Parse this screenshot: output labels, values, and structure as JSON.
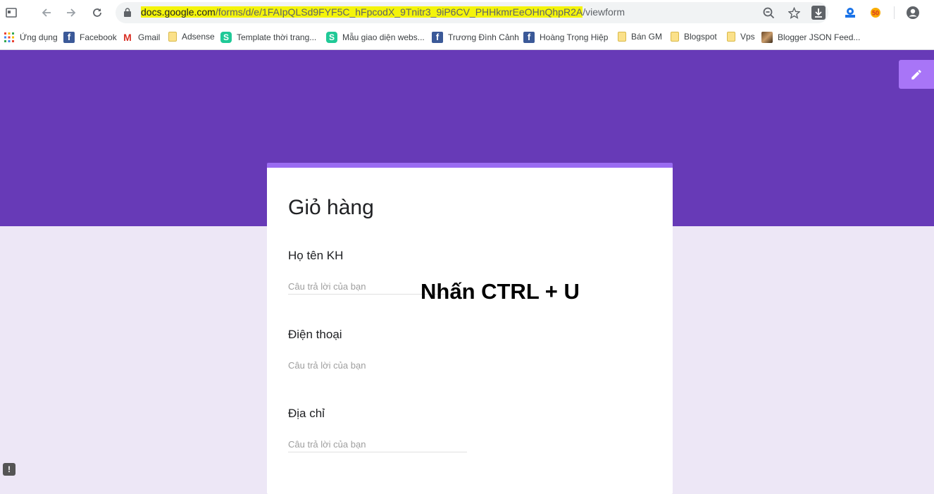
{
  "browser": {
    "url": {
      "domain_hl": "docs.google.com",
      "path_hl": "/forms/d/e/1FAIpQLSd9FYF5C_hFpcodX_9Tnitr3_9iP6CV_PHHkmrEeOHnQhpR2A",
      "suffix": "/viewform"
    },
    "nav_icons": [
      "sidebar-icon",
      "back-icon",
      "forward-icon",
      "reload-icon",
      "lock-icon"
    ],
    "right_icons": [
      "zoom-out-icon",
      "star-icon",
      "download-icon",
      "extension-icon",
      "extension-icon-2",
      "account-icon"
    ]
  },
  "bookmarks": [
    {
      "label": "Ứng dụng",
      "icon": "apps-grid-icon"
    },
    {
      "label": "Facebook",
      "icon": "facebook-icon"
    },
    {
      "label": "Gmail",
      "icon": "gmail-icon"
    },
    {
      "label": "Adsense",
      "icon": "folder-icon"
    },
    {
      "label": "Template thời trang...",
      "icon": "s-logo-icon"
    },
    {
      "label": "Mẫu giao diện webs...",
      "icon": "s-logo-icon"
    },
    {
      "label": "Trương Đình Cảnh",
      "icon": "facebook-icon"
    },
    {
      "label": "Hoàng Trọng Hiệp",
      "icon": "facebook-icon"
    },
    {
      "label": "Bán GM",
      "icon": "folder-icon"
    },
    {
      "label": "Blogspot",
      "icon": "folder-icon"
    },
    {
      "label": "Vps",
      "icon": "folder-icon"
    },
    {
      "label": "Blogger JSON Feed...",
      "icon": "photo-icon"
    }
  ],
  "form": {
    "title": "Giỏ hàng",
    "questions": [
      {
        "label": "Họ tên KH",
        "placeholder": "Câu trả lời của bạn"
      },
      {
        "label": "Điện thoại",
        "placeholder": "Câu trả lời của bạn"
      },
      {
        "label": "Địa chỉ",
        "placeholder": "Câu trả lời của bạn"
      }
    ]
  },
  "overlay": {
    "text": "Nhấn CTRL + U"
  },
  "colors": {
    "header": "#673ab7",
    "accent": "#9a6cf2",
    "background": "#ede7f6",
    "edit_button": "#a875f7",
    "url_highlight": "#f4f40a"
  }
}
